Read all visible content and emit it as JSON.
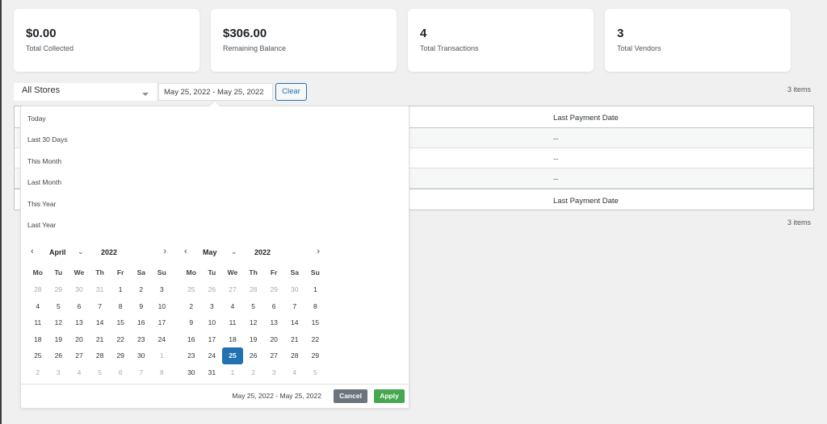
{
  "stats": [
    {
      "value": "$0.00",
      "label": "Total Collected"
    },
    {
      "value": "$306.00",
      "label": "Remaining Balance"
    },
    {
      "value": "4",
      "label": "Total Transactions"
    },
    {
      "value": "3",
      "label": "Total Vendors"
    }
  ],
  "filters": {
    "store_select": "All Stores",
    "date_range": "May 25, 2022 - May 25, 2022",
    "clear_label": "Clear",
    "items_count": "3 items"
  },
  "table": {
    "column_header": "Last Payment Date",
    "rows": [
      "--",
      "--",
      "--"
    ],
    "footer_header": "Last Payment Date",
    "items_count_bottom": "3 items"
  },
  "date_picker": {
    "ranges": [
      "Today",
      "Last 30 Days",
      "This Month",
      "Last Month",
      "This Year",
      "Last Year"
    ],
    "weekdays": [
      "Mo",
      "Tu",
      "We",
      "Th",
      "Fr",
      "Sa",
      "Su"
    ],
    "left_calendar": {
      "month": "April",
      "year": "2022",
      "days": [
        [
          "28",
          "off"
        ],
        [
          "29",
          "off"
        ],
        [
          "30",
          "off"
        ],
        [
          "31",
          "off"
        ],
        [
          "1",
          ""
        ],
        [
          "2",
          ""
        ],
        [
          "3",
          ""
        ],
        [
          "4",
          ""
        ],
        [
          "5",
          ""
        ],
        [
          "6",
          ""
        ],
        [
          "7",
          ""
        ],
        [
          "8",
          ""
        ],
        [
          "9",
          ""
        ],
        [
          "10",
          ""
        ],
        [
          "11",
          ""
        ],
        [
          "12",
          ""
        ],
        [
          "13",
          ""
        ],
        [
          "14",
          ""
        ],
        [
          "15",
          ""
        ],
        [
          "16",
          ""
        ],
        [
          "17",
          ""
        ],
        [
          "18",
          ""
        ],
        [
          "19",
          ""
        ],
        [
          "20",
          ""
        ],
        [
          "21",
          ""
        ],
        [
          "22",
          ""
        ],
        [
          "23",
          ""
        ],
        [
          "24",
          ""
        ],
        [
          "25",
          ""
        ],
        [
          "26",
          ""
        ],
        [
          "27",
          ""
        ],
        [
          "28",
          ""
        ],
        [
          "29",
          ""
        ],
        [
          "30",
          ""
        ],
        [
          "1",
          "off"
        ],
        [
          "2",
          "off"
        ],
        [
          "3",
          "off"
        ],
        [
          "4",
          "off"
        ],
        [
          "5",
          "off"
        ],
        [
          "6",
          "off"
        ],
        [
          "7",
          "off"
        ],
        [
          "8",
          "off"
        ]
      ]
    },
    "right_calendar": {
      "month": "May",
      "year": "2022",
      "days": [
        [
          "25",
          "off"
        ],
        [
          "26",
          "off"
        ],
        [
          "27",
          "off"
        ],
        [
          "28",
          "off"
        ],
        [
          "29",
          "off"
        ],
        [
          "30",
          "off"
        ],
        [
          "1",
          ""
        ],
        [
          "2",
          ""
        ],
        [
          "3",
          ""
        ],
        [
          "4",
          ""
        ],
        [
          "5",
          ""
        ],
        [
          "6",
          ""
        ],
        [
          "7",
          ""
        ],
        [
          "8",
          ""
        ],
        [
          "9",
          ""
        ],
        [
          "10",
          ""
        ],
        [
          "11",
          ""
        ],
        [
          "12",
          ""
        ],
        [
          "13",
          ""
        ],
        [
          "14",
          ""
        ],
        [
          "15",
          ""
        ],
        [
          "16",
          ""
        ],
        [
          "17",
          ""
        ],
        [
          "18",
          ""
        ],
        [
          "19",
          ""
        ],
        [
          "20",
          ""
        ],
        [
          "21",
          ""
        ],
        [
          "22",
          ""
        ],
        [
          "23",
          ""
        ],
        [
          "24",
          ""
        ],
        [
          "25",
          "sel"
        ],
        [
          "26",
          ""
        ],
        [
          "27",
          ""
        ],
        [
          "28",
          ""
        ],
        [
          "29",
          ""
        ],
        [
          "30",
          ""
        ],
        [
          "31",
          ""
        ],
        [
          "1",
          "off"
        ],
        [
          "2",
          "off"
        ],
        [
          "3",
          "off"
        ],
        [
          "4",
          "off"
        ],
        [
          "5",
          "off"
        ]
      ]
    },
    "selected_range": "May 25, 2022 - May 25, 2022",
    "cancel_label": "Cancel",
    "apply_label": "Apply",
    "icons": {
      "prev": "‹",
      "next": "›",
      "month_caret": "⌄"
    }
  }
}
